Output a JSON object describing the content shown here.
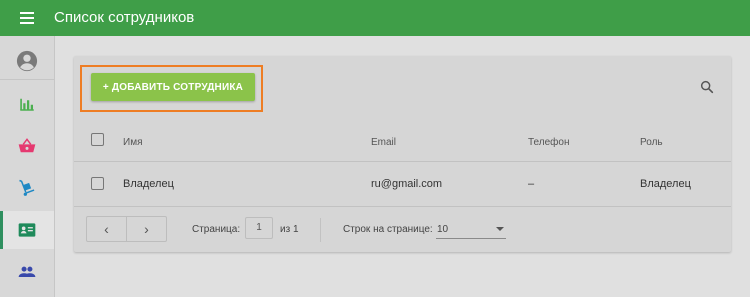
{
  "app": {
    "title": "Список сотрудников"
  },
  "sidebar": {
    "items": [
      {
        "icon": "account-circle-icon",
        "active": false
      },
      {
        "icon": "bar-chart-icon",
        "active": false
      },
      {
        "icon": "shopping-basket-icon",
        "active": false
      },
      {
        "icon": "hand-truck-icon",
        "active": false
      },
      {
        "icon": "id-card-icon",
        "active": true
      },
      {
        "icon": "people-icon",
        "active": false
      }
    ]
  },
  "toolbar": {
    "add_label": "+ ДОБАВИТЬ СОТРУДНИКА",
    "search_icon": "search-icon"
  },
  "table": {
    "columns": [
      "Имя",
      "Email",
      "Телефон",
      "Роль"
    ],
    "rows": [
      {
        "name": "Владелец",
        "email": "ru@gmail.com",
        "phone": "–",
        "role": "Владелец"
      }
    ]
  },
  "pagination": {
    "prev": "‹",
    "next": "›",
    "page_label": "Страница:",
    "page_value": "1",
    "of_label": "из 1",
    "rows_label": "Строк на странице:",
    "rows_value": "10"
  },
  "colors": {
    "appbar": "#3f9e48",
    "add_button": "#8bc34a",
    "highlight": "#ee7d24",
    "active_indicator": "#2f8f5f",
    "chart_icon": "#4caf50",
    "basket_icon": "#e53970",
    "truck_icon": "#1e88c4",
    "card_icon": "#1f8a5b",
    "people_icon": "#3949ab"
  }
}
